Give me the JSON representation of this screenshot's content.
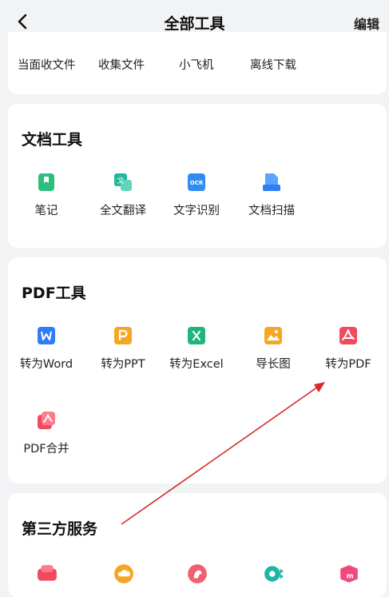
{
  "header": {
    "title": "全部工具",
    "edit_label": "编辑"
  },
  "top_row": {
    "items": [
      "当面收文件",
      "收集文件",
      "小飞机",
      "离线下载"
    ]
  },
  "doc_tools": {
    "title": "文档工具",
    "items": [
      {
        "label": "笔记",
        "icon": "note-icon",
        "color": "#2bbf7b"
      },
      {
        "label": "全文翻译",
        "icon": "translate-icon",
        "color": "#22b8a0"
      },
      {
        "label": "文字识别",
        "icon": "ocr-icon",
        "color": "#2f8cf0"
      },
      {
        "label": "文档扫描",
        "icon": "scan-icon",
        "color": "#2f7ef5"
      }
    ]
  },
  "pdf_tools": {
    "title": "PDF工具",
    "items": [
      {
        "label": "转为Word",
        "icon": "word-icon",
        "color": "#2f7ef5"
      },
      {
        "label": "转为PPT",
        "icon": "ppt-icon",
        "color": "#f5a623"
      },
      {
        "label": "转为Excel",
        "icon": "excel-icon",
        "color": "#1fb57c"
      },
      {
        "label": "导长图",
        "icon": "long-image-icon",
        "color": "#f5a623"
      },
      {
        "label": "转为PDF",
        "icon": "pdf-icon",
        "color": "#f04a5d"
      },
      {
        "label": "PDF合并",
        "icon": "pdf-merge-icon",
        "color": "#f04a5d"
      }
    ]
  },
  "third_party": {
    "title": "第三方服务",
    "items": [
      {
        "icon": "cards-icon",
        "color": "#f04a5d"
      },
      {
        "icon": "cloud-icon",
        "color": "#f5a623"
      },
      {
        "icon": "bird-icon",
        "color": "#f06070"
      },
      {
        "icon": "video-eye-icon",
        "color": "#1fb5a5"
      },
      {
        "icon": "m-logo-icon",
        "color": "#f04a7d"
      }
    ]
  },
  "colors": {
    "background": "#f2f3f5",
    "card": "#ffffff",
    "annotation_arrow": "#d32a2a"
  }
}
